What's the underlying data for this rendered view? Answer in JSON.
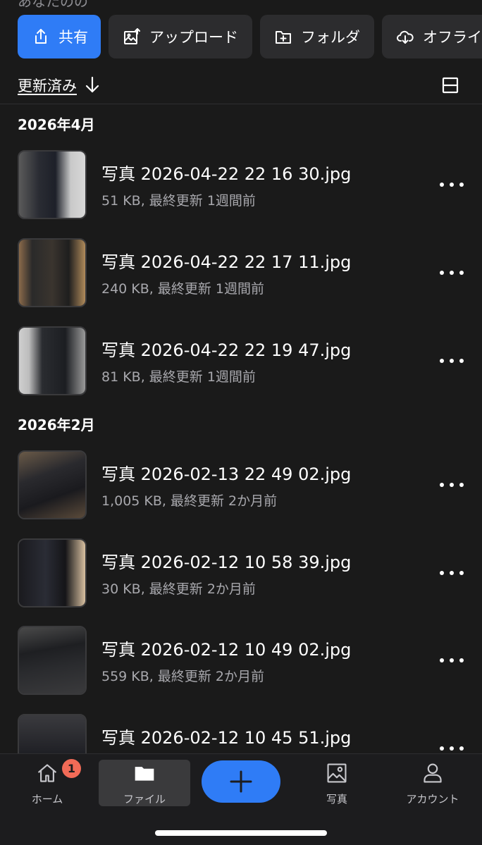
{
  "header": {
    "partial_label": "あなたのの"
  },
  "actions": [
    {
      "label": "共有",
      "icon": "share-icon"
    },
    {
      "label": "アップロード",
      "icon": "upload-image-icon"
    },
    {
      "label": "フォルダ",
      "icon": "new-folder-icon"
    },
    {
      "label": "オフライ",
      "icon": "cloud-download-icon"
    }
  ],
  "sort": {
    "label": "更新済み",
    "icon": "arrow-down-icon",
    "layout_icon": "layout-toggle-icon"
  },
  "sections": [
    {
      "title": "2026年4月",
      "files": [
        {
          "name": "写真 2026-04-22 22 16 30.jpg",
          "meta": "51 KB, 最終更新 1週間前"
        },
        {
          "name": "写真 2026-04-22 22 17 11.jpg",
          "meta": "240 KB, 最終更新 1週間前"
        },
        {
          "name": "写真 2026-04-22 22 19 47.jpg",
          "meta": "81 KB, 最終更新 1週間前"
        }
      ]
    },
    {
      "title": "2026年2月",
      "files": [
        {
          "name": "写真 2026-02-13 22 49 02.jpg",
          "meta": "1,005 KB, 最終更新 2か月前"
        },
        {
          "name": "写真 2026-02-12 10 58 39.jpg",
          "meta": "30 KB, 最終更新 2か月前"
        },
        {
          "name": "写真 2026-02-12 10 49 02.jpg",
          "meta": "559 KB, 最終更新 2か月前"
        },
        {
          "name": "写真 2026-02-12 10 45 51.jpg",
          "meta": ""
        }
      ]
    }
  ],
  "tabbar": {
    "home": {
      "label": "ホーム",
      "badge": "1"
    },
    "files": {
      "label": "ファイル"
    },
    "photos": {
      "label": "写真"
    },
    "account": {
      "label": "アカウント"
    }
  },
  "colors": {
    "accent": "#2f7cf6",
    "background": "#1a1a1a",
    "badge": "#f26b57"
  }
}
